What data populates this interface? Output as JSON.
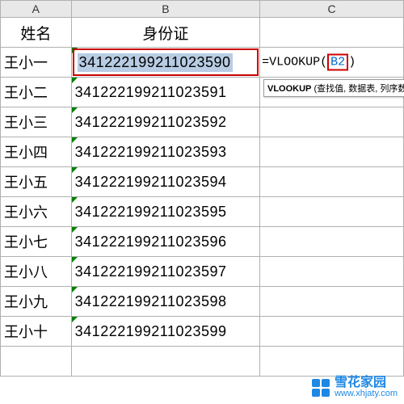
{
  "columns": {
    "a": "A",
    "b": "B",
    "c": "C"
  },
  "headers": {
    "name": "姓名",
    "id": "身份证"
  },
  "rows": [
    {
      "name": "王小一",
      "id": "341222199211023590"
    },
    {
      "name": "王小二",
      "id": "341222199211023591"
    },
    {
      "name": "王小三",
      "id": "341222199211023592"
    },
    {
      "name": "王小四",
      "id": "341222199211023593"
    },
    {
      "name": "王小五",
      "id": "341222199211023594"
    },
    {
      "name": "王小六",
      "id": "341222199211023595"
    },
    {
      "name": "王小七",
      "id": "341222199211023596"
    },
    {
      "name": "王小八",
      "id": "341222199211023597"
    },
    {
      "name": "王小九",
      "id": "341222199211023598"
    },
    {
      "name": "王小十",
      "id": "341222199211023599"
    }
  ],
  "formula": {
    "prefix": "=VLOOKUP(",
    "arg": "B2",
    "suffix": ")"
  },
  "tooltip": {
    "fn": "VLOOKUP",
    "args": "(查找值, 数据表, 列序数, [匹"
  },
  "watermark": {
    "title": "雪花家园",
    "url": "www.xhjaty.com"
  },
  "chart_data": {
    "type": "table",
    "title": "身份证",
    "columns": [
      "姓名",
      "身份证"
    ],
    "rows": [
      [
        "王小一",
        "341222199211023590"
      ],
      [
        "王小二",
        "341222199211023591"
      ],
      [
        "王小三",
        "341222199211023592"
      ],
      [
        "王小四",
        "341222199211023593"
      ],
      [
        "王小五",
        "341222199211023594"
      ],
      [
        "王小六",
        "341222199211023595"
      ],
      [
        "王小七",
        "341222199211023596"
      ],
      [
        "王小八",
        "341222199211023597"
      ],
      [
        "王小九",
        "341222199211023598"
      ],
      [
        "王小十",
        "341222199211023599"
      ]
    ],
    "formula": "=VLOOKUP(B2)"
  }
}
